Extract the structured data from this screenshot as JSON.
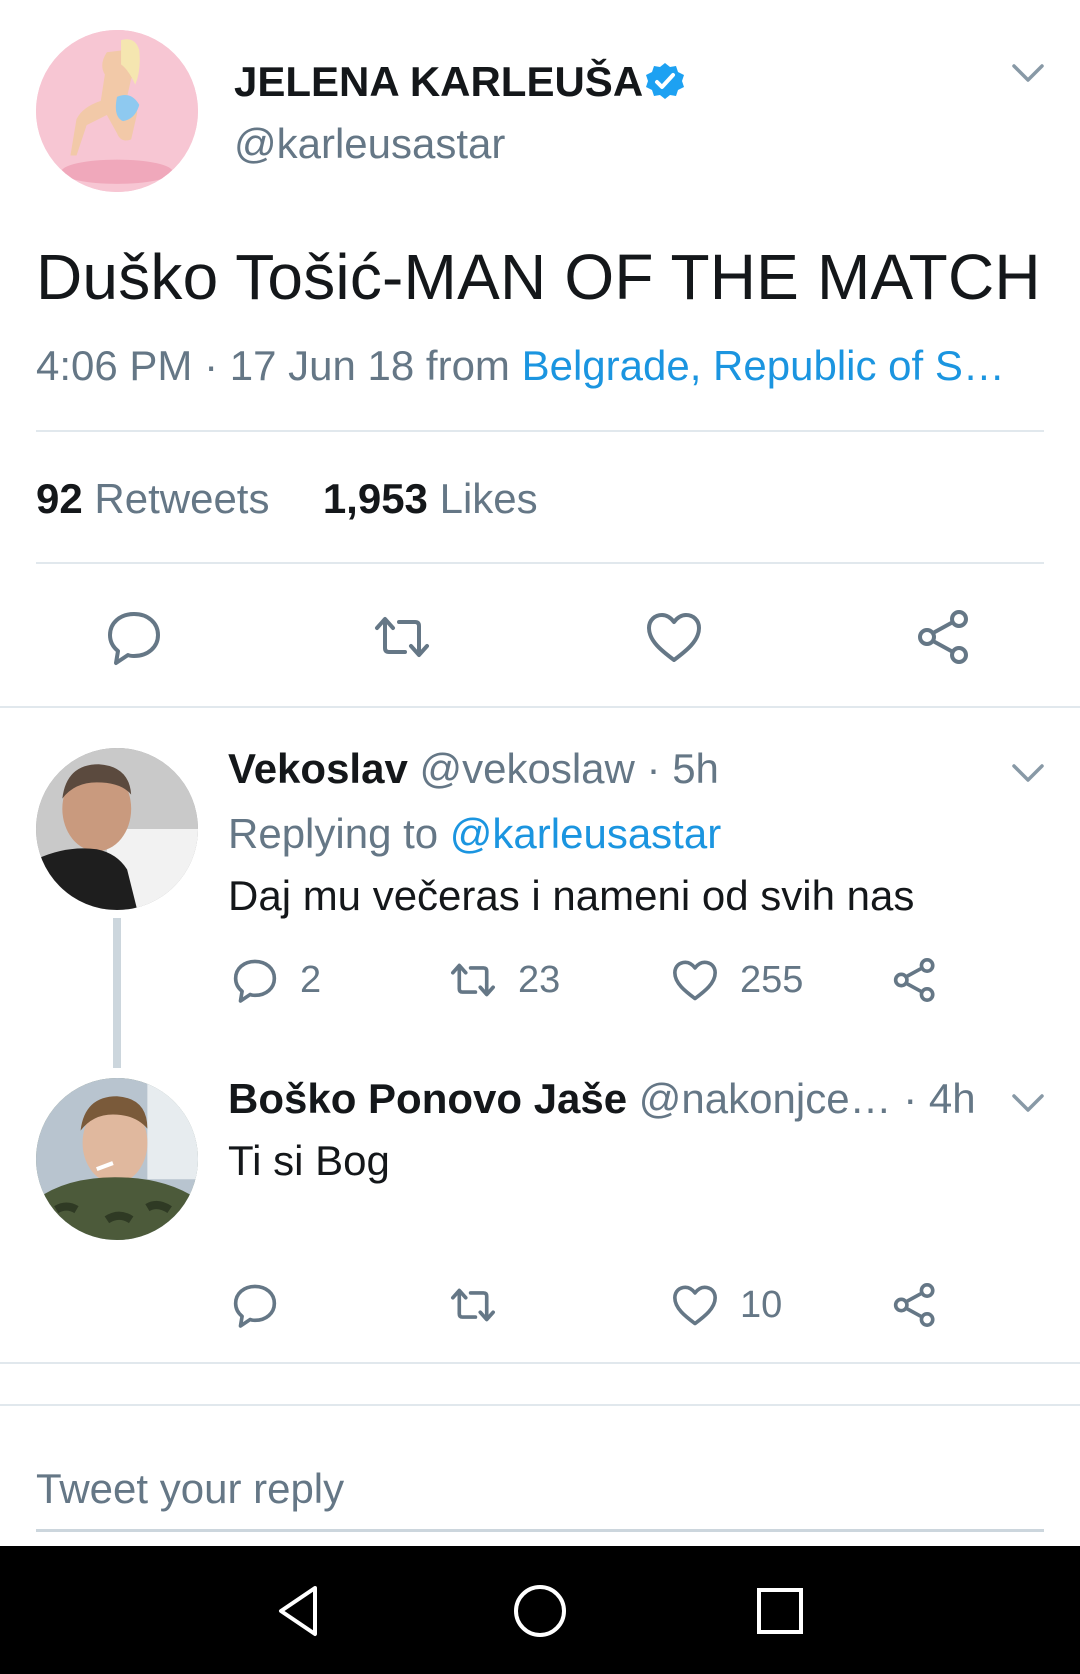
{
  "main_tweet": {
    "display_name": "JELENA KARLEUŠA",
    "handle": "@karleusastar",
    "text": "Duško Tošić-MAN OF THE MATCH",
    "time": "4:06 PM",
    "date": "17 Jun 18",
    "from_label": "from",
    "location": "Belgrade, Republic of S…",
    "retweets_count": "92",
    "retweets_label": "Retweets",
    "likes_count": "1,953",
    "likes_label": "Likes"
  },
  "replies": [
    {
      "display_name": "Vekoslav",
      "handle": "@vekoslaw",
      "age": "5h",
      "replying_label": "Replying to",
      "replying_to": "@karleusastar",
      "text": "Daj mu večeras i nameni od svih nas",
      "reply_count": "2",
      "retweet_count": "23",
      "like_count": "255"
    },
    {
      "display_name": "Boško Ponovo Jaše",
      "handle": "@nakonjce…",
      "age": "4h",
      "text": "Ti si Bog",
      "reply_count": "",
      "retweet_count": "",
      "like_count": "10"
    }
  ],
  "composer": {
    "placeholder": "Tweet your reply"
  },
  "colors": {
    "link_blue": "#1b95e0",
    "verified_blue": "#1da1f2",
    "secondary_text": "#657786",
    "divider": "#e1e8ed"
  },
  "icons": {
    "verified": "verified-badge-icon",
    "reply": "reply-icon",
    "retweet": "retweet-icon",
    "like": "heart-icon",
    "share": "share-icon",
    "more": "chevron-down-icon",
    "nav_back": "back-triangle-icon",
    "nav_home": "home-circle-icon",
    "nav_recents": "recents-square-icon"
  }
}
